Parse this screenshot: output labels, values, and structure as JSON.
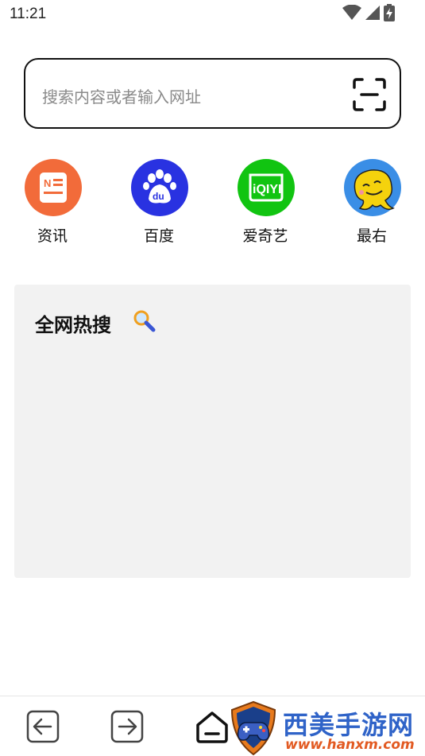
{
  "status_bar": {
    "time": "11:21",
    "icons": [
      "wifi-icon",
      "cellular-signal-icon",
      "battery-charging-icon"
    ]
  },
  "search": {
    "placeholder": "搜索内容或者输入网址",
    "scan_icon": "scan-icon"
  },
  "shortcuts": [
    {
      "label": "资讯",
      "icon": "news-icon",
      "color": "#f26b3a"
    },
    {
      "label": "百度",
      "icon": "baidu-paw-icon",
      "color": "#2932e1"
    },
    {
      "label": "爱奇艺",
      "icon": "iqiyi-icon",
      "color": "#11c411"
    },
    {
      "label": "最右",
      "icon": "zuiyou-icon",
      "color": "#3a8ee6"
    }
  ],
  "hot_search": {
    "title": "全网热搜",
    "icon": "magnifier-icon"
  },
  "bottom_nav": {
    "items": [
      {
        "name": "back",
        "icon": "back-arrow-icon"
      },
      {
        "name": "forward",
        "icon": "forward-arrow-icon"
      },
      {
        "name": "home",
        "icon": "home-icon"
      }
    ]
  },
  "watermark": {
    "text": "西美手游网",
    "url": "www.hanxm.com"
  },
  "colors": {
    "panel_bg": "#f2f2f2",
    "placeholder": "#8a8a8a",
    "watermark_blue": "#2f63c8",
    "watermark_orange": "#e25a22"
  }
}
